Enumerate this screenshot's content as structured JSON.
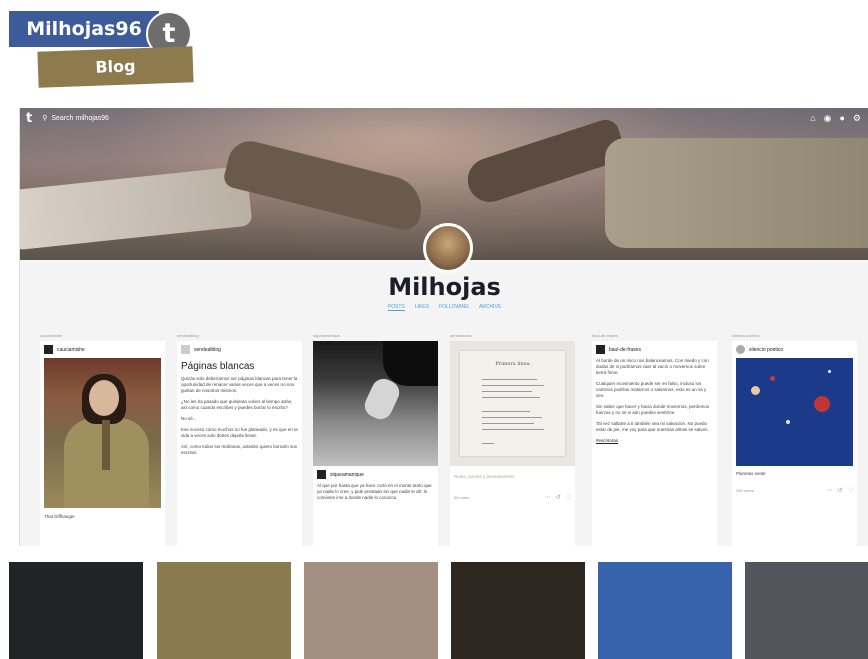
{
  "header": {
    "title": "Milhojas96",
    "logo_letter": "t",
    "subtitle": "Blog"
  },
  "topbar": {
    "logo_letter": "t",
    "search_placeholder": "Search milhojas96"
  },
  "blog": {
    "title": "Milhojas",
    "tabs": [
      "POSTS",
      "LIKES",
      "FOLLOWING",
      "ARCHIVE"
    ]
  },
  "posts": [
    {
      "reblog": "cauciamishe",
      "user": "cauciamishe",
      "caption": "That Diffhanger"
    },
    {
      "reblog": "sendealblog",
      "user": "sendealblog",
      "title": "Páginas blancas",
      "paragraphs": [
        "Quizás solo deberíamos ser páginas blancas para tener la oportunidad de renacer varias veces que a veces no nos gustan de nosotros mismos.",
        "¿No les ha pasado que quisieran volver al tiempo atrás, así como cuando escribes y puedes borrar lo escrito?",
        "No sé...",
        "Ese suceso como muchos no fue planeado, y es que en la vida a veces solo debes dejarte llevar.",
        "Así, como todos los mañanas, ustedes quiero borrarlo sus escritos"
      ]
    },
    {
      "reblog": "siqueamanique",
      "user": "siqueamanique",
      "caption": "Al que por hasta que ya hace cortó en el monte tanto que ya nadie lo cree, y pide prestado sin que nadie le dé: le conviene irse a donde nadie lo conozca."
    },
    {
      "reblog": "primaverass",
      "poem_title": "Primera línea",
      "caption": "Notas, poesía y pensamientos",
      "notes": "56 notes"
    },
    {
      "reblog": "baul-de-frases",
      "user": "baul-de-frases",
      "paragraphs": [
        "Al borde de un risco nos balanceamos. Con miedo y con dudas de si podríamos caer al vacío o movernos sobre tierra firme.",
        "Cualquier movimiento puede ser en falso, incluso los caminos podrían matarnos o salvarnos, esto es un va y ven.",
        "Sin saber que hacer y hacia donde movernos, perdemos fuerzas y no se si aún puedes sentirme.",
        "Tal vez saltarte a ti también sea mi salvación. No puedo estar de pie, me voy para que nuestras almas se salven."
      ],
      "link": "#escritoras"
    },
    {
      "reblog": "silencio-poetico",
      "user": "silencio poetico",
      "caption": "Planetas sentir",
      "notes": "260 notes"
    }
  ],
  "colors": {
    "label_blue": "#3d5a99",
    "label_olive": "#8d7b4e",
    "tab_blue": "#49a3d6",
    "palette": [
      "#222327",
      "#8a7b4f",
      "#a58e82",
      "#2f2821",
      "#3763ad",
      "#54555c"
    ]
  },
  "icons": [
    "home-icon",
    "compass-icon",
    "chat-icon",
    "account-icon",
    "search-icon"
  ]
}
